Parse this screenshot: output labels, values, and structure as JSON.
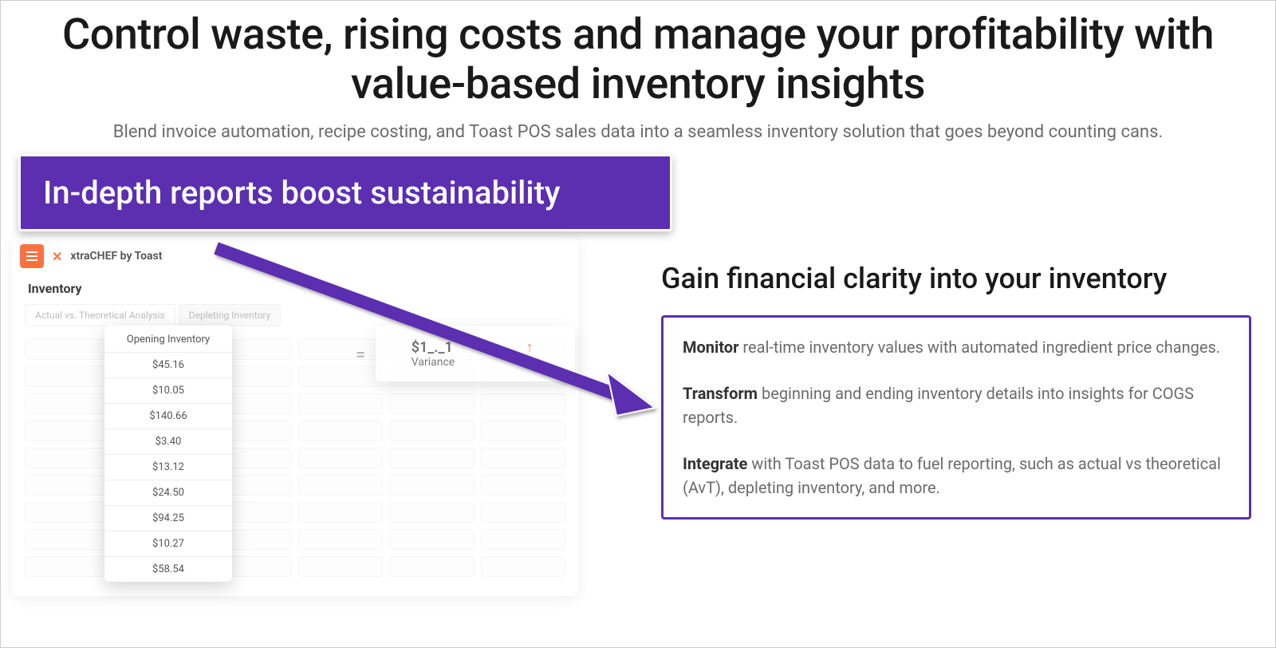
{
  "hero": {
    "headline": "Control waste, rising costs and manage your profitability with value-based inventory insights",
    "sub": "Blend invoice automation, recipe costing, and Toast POS sales data into a seamless inventory solution that goes beyond counting cans."
  },
  "callout": "In-depth reports boost sustainability",
  "app": {
    "brand": "xtraCHEF by Toast",
    "title": "Inventory",
    "tabs": [
      "Actual vs. Theoretical Analysis",
      "Depleting Inventory"
    ],
    "opening_header": "Opening Inventory",
    "opening_values": [
      "$45.16",
      "$10.05",
      "$140.66",
      "$3.40",
      "$13.12",
      "$24.50",
      "$94.25",
      "$10.27",
      "$58.54"
    ],
    "variance_amount": "$1_._1",
    "variance_label": "Variance",
    "variance_pct": "_%"
  },
  "right": {
    "heading": "Gain financial clarity into your inventory",
    "f1b": "Monitor",
    "f1t": " real-time inventory values with automated ingredient price changes.",
    "f2b": "Transform",
    "f2t": " beginning and ending inventory details into insights for COGS reports.",
    "f3b": "Integrate",
    "f3t": " with Toast POS data to fuel reporting, such as actual vs theoretical (AvT), depleting inventory, and more."
  }
}
